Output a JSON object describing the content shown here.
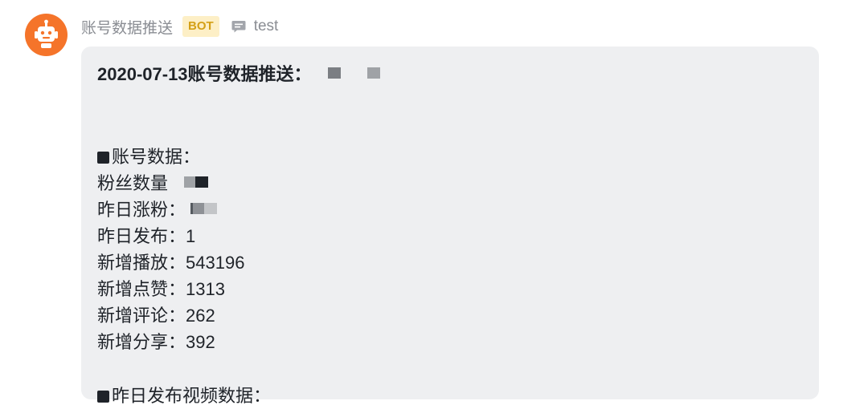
{
  "header": {
    "sender": "账号数据推送",
    "badge": "BOT",
    "group": "test"
  },
  "avatar_icon": "robot-icon",
  "chat_icon": "chat-bubble-icon",
  "message": {
    "title": "2020-07-13账号数据推送：",
    "section1_heading": "账号数据：",
    "rows": [
      {
        "label": "粉丝数量",
        "value": ""
      },
      {
        "label": "昨日涨粉：",
        "value": ""
      },
      {
        "label": "昨日发布：",
        "value": "1"
      },
      {
        "label": "新增播放：",
        "value": "543196"
      },
      {
        "label": "新增点赞：",
        "value": "1313"
      },
      {
        "label": "新增评论：",
        "value": "262"
      },
      {
        "label": "新增分享：",
        "value": "392"
      }
    ],
    "section2_heading": "昨日发布视频数据："
  },
  "colors": {
    "avatar_bg": "#f5742a",
    "badge_bg": "#fdefc6",
    "badge_text": "#d4a017",
    "bubble_bg": "#eeeff1",
    "text": "#1f2329",
    "muted": "#8a8d93"
  }
}
